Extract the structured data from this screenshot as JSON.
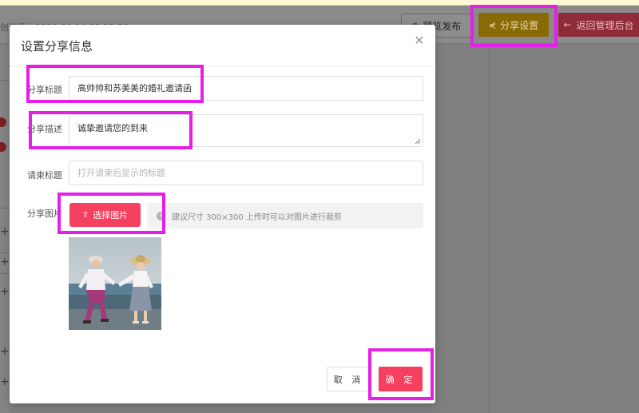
{
  "background": {
    "timestamp_text": "创建于：2020-06-14 08:23:56",
    "preview_label": "预览发布",
    "share_settings_label": "分享设置",
    "back_admin_label": "返回管理后台"
  },
  "modal": {
    "title": "设置分享信息",
    "fields": {
      "share_title_label": "分享标题",
      "share_title_value": "高帅帅和苏美美的婚礼邀请函",
      "share_desc_label": "分享描述",
      "share_desc_value": "诚挚邀请您的到来",
      "invite_title_label": "请柬标题",
      "invite_title_placeholder": "打开请柬后显示的标题",
      "share_image_label": "分享图片"
    },
    "upload_button_label": "选择图片",
    "upload_hint": "建议尺寸 300×300 上传时可以对图片进行裁剪",
    "cancel_label": "取 消",
    "confirm_label": "确 定"
  },
  "colors": {
    "primary": "#f5405f",
    "highlight": "#e51fe8",
    "share_btn_bg": "#8a6a06"
  },
  "icons": [
    "close-icon",
    "share-icon",
    "eye-icon",
    "arrow-left-icon",
    "upload-icon",
    "info-icon"
  ]
}
